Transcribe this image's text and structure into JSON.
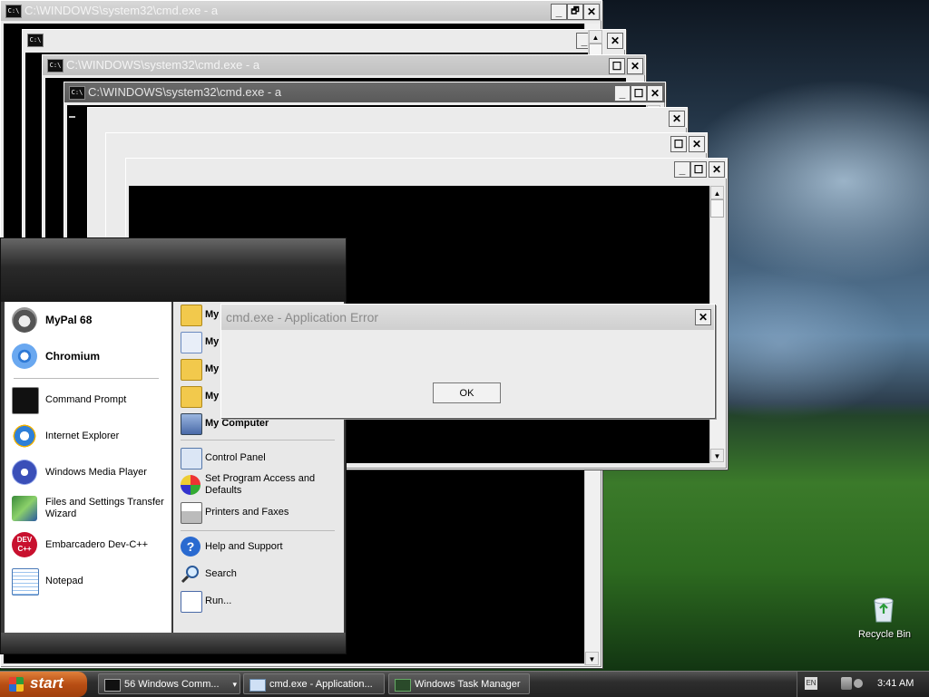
{
  "desktop": {
    "recycle_bin_label": "Recycle Bin"
  },
  "cmd_windows": {
    "title_full": "C:\\WINDOWS\\system32\\cmd.exe - a",
    "control_min": "_",
    "control_restore": "🗗",
    "control_max": "☐",
    "control_close": "✕",
    "icon_text": "C:\\",
    "scroll_up": "▲",
    "scroll_down": "▼"
  },
  "error_dialog": {
    "title": "cmd.exe - Application Error",
    "message": "",
    "ok_label": "OK",
    "close": "✕"
  },
  "start_menu": {
    "pinned": [
      {
        "label": "MyPal 68",
        "icon": "raccoon-icon",
        "bold": true
      },
      {
        "label": "Chromium",
        "icon": "chromium-icon",
        "bold": true
      }
    ],
    "recent": [
      {
        "label": "Command Prompt",
        "icon": "command-prompt-icon"
      },
      {
        "label": "Internet Explorer",
        "icon": "internet-explorer-icon"
      },
      {
        "label": "Windows Media Player",
        "icon": "media-player-icon"
      },
      {
        "label": "Files and Settings Transfer Wizard",
        "icon": "transfer-wizard-icon"
      },
      {
        "label": "Embarcadero Dev-C++",
        "icon": "devcpp-icon"
      },
      {
        "label": "Notepad",
        "icon": "notepad-icon"
      }
    ],
    "devcpp_icon_text": "DEV\nC++",
    "right": [
      {
        "label": "My",
        "icon": "my-documents-icon",
        "bold": true
      },
      {
        "label": "My",
        "icon": "my-recent-documents-icon",
        "bold": true
      },
      {
        "label": "My",
        "icon": "my-pictures-icon",
        "bold": true
      },
      {
        "label": "My",
        "icon": "my-music-icon",
        "bold": true
      },
      {
        "label": "My Computer",
        "icon": "my-computer-icon",
        "bold": true
      },
      {
        "label": "Control Panel",
        "icon": "control-panel-icon"
      },
      {
        "label": "Set Program Access and Defaults",
        "icon": "program-access-icon"
      },
      {
        "label": "Printers and Faxes",
        "icon": "printer-icon"
      },
      {
        "label": "Help and Support",
        "icon": "help-icon"
      },
      {
        "label": "Search",
        "icon": "search-icon"
      },
      {
        "label": "Run...",
        "icon": "run-icon"
      }
    ]
  },
  "taskbar": {
    "start_label": "start",
    "tasks": [
      {
        "label": "56 Windows Comm...",
        "icon": "cmd-icon"
      },
      {
        "label": "cmd.exe - Application...",
        "icon": "window-icon"
      },
      {
        "label": "Windows Task Manager",
        "icon": "task-manager-icon"
      }
    ],
    "group_arrow": "▾",
    "language": "EN",
    "clock": "3:41 AM"
  },
  "colors": {
    "title_active": "#5f5f5f",
    "start_button": "#c0561c",
    "taskbar": "#2e2e2e"
  }
}
